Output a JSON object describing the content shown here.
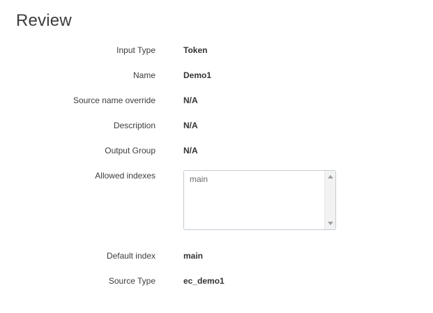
{
  "page": {
    "title": "Review"
  },
  "review": {
    "input_type": {
      "label": "Input Type",
      "value": "Token"
    },
    "name": {
      "label": "Name",
      "value": "Demo1"
    },
    "source_name_override": {
      "label": "Source name override",
      "value": "N/A"
    },
    "description": {
      "label": "Description",
      "value": "N/A"
    },
    "output_group": {
      "label": "Output Group",
      "value": "N/A"
    },
    "allowed_indexes": {
      "label": "Allowed indexes",
      "options": [
        "main"
      ]
    },
    "default_index": {
      "label": "Default index",
      "value": "main"
    },
    "source_type": {
      "label": "Source Type",
      "value": "ec_demo1"
    }
  },
  "icons": {
    "scroll_up": "scroll-up-arrow-icon",
    "scroll_down": "scroll-down-arrow-icon"
  }
}
